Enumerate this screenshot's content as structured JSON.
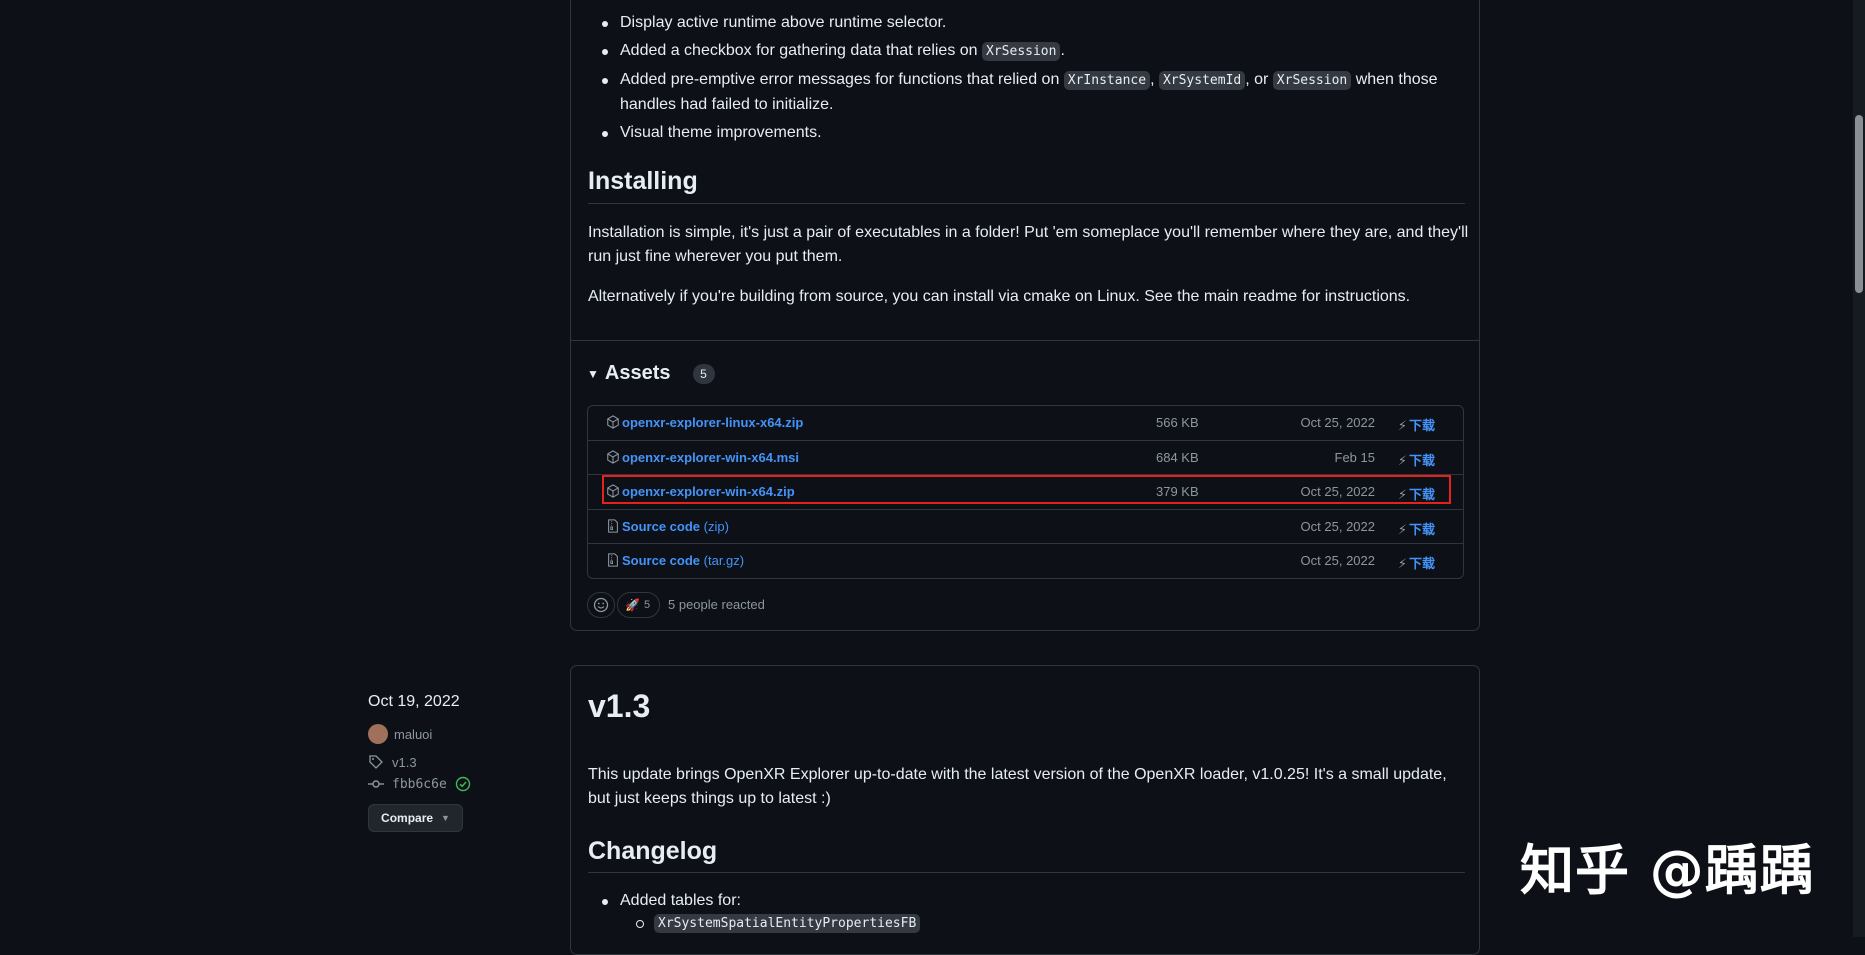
{
  "release1": {
    "bullets_top": [
      {
        "pre": "Display active runtime above runtime selector."
      },
      {
        "pre": "Added a checkbox for gathering data that relies on ",
        "code": "XrSession",
        "post": "."
      },
      {
        "pre": "Added pre-emptive error messages for functions that relied on ",
        "code1": "XrInstance",
        "mid1": ", ",
        "code2": "XrSystemId",
        "mid2": ", or ",
        "code3": "XrSession",
        "post": " when those handles had failed to initialize."
      },
      {
        "pre": "Visual theme improvements."
      }
    ],
    "installing_heading": "Installing",
    "installing_p1": "Installation is simple, it's just a pair of executables in a folder! Put 'em someplace you'll remember where they are, and they'll run just fine wherever you put them.",
    "installing_p2": "Alternatively if you're building from source, you can install via cmake on Linux. See the main readme for instructions.",
    "assets": {
      "label": "Assets",
      "count": "5",
      "rows": [
        {
          "name": "openxr-explorer-linux-x64.zip",
          "sub": "",
          "size": "566 KB",
          "date": "Oct 25, 2022",
          "download": "下载",
          "icon": "package-icon"
        },
        {
          "name": "openxr-explorer-win-x64.msi",
          "sub": "",
          "size": "684 KB",
          "date": "Feb 15",
          "download": "下载",
          "icon": "package-icon"
        },
        {
          "name": "openxr-explorer-win-x64.zip",
          "sub": "",
          "size": "379 KB",
          "date": "Oct 25, 2022",
          "download": "下载",
          "icon": "package-icon"
        },
        {
          "name": "Source code",
          "sub": " (zip)",
          "size": "",
          "date": "Oct 25, 2022",
          "download": "下载",
          "icon": "file-zip-icon"
        },
        {
          "name": "Source code",
          "sub": " (tar.gz)",
          "size": "",
          "date": "Oct 25, 2022",
          "download": "下载",
          "icon": "file-zip-icon"
        }
      ],
      "highlighted_row": 2
    },
    "reactions": {
      "rocket_count": "5",
      "summary": "5 people reacted"
    }
  },
  "release2": {
    "date": "Oct 19, 2022",
    "author": "maluoi",
    "tag": "v1.3",
    "commit": "fbb6c6e",
    "compare_label": "Compare",
    "title": "v1.3",
    "intro": "This update brings OpenXR Explorer up-to-date with the latest version of the OpenXR loader, v1.0.25! It's a small update, but just keeps things up to latest :)",
    "changelog_heading": "Changelog",
    "changelog_item": "Added tables for:",
    "changelog_sub": "XrSystemSpatialEntityPropertiesFB"
  },
  "watermark": "知乎 @踽踽",
  "colors": {
    "background": "#0d1117",
    "link": "#4493f8",
    "highlight_border": "#e5211c",
    "verified": "#3fb950"
  }
}
